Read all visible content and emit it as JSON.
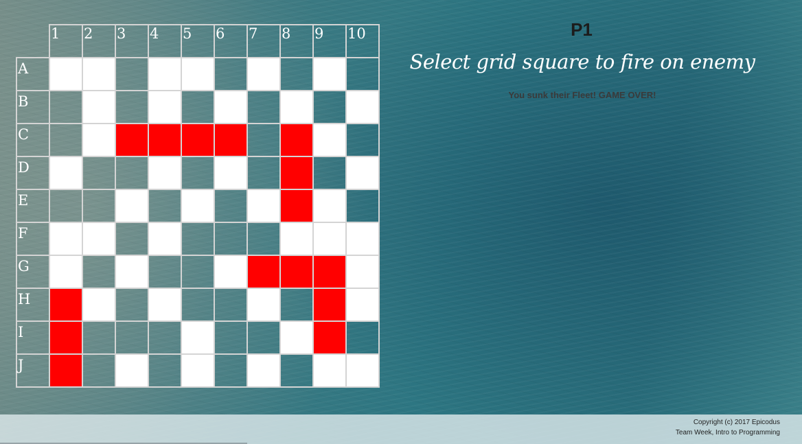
{
  "board": {
    "columns": [
      "1",
      "2",
      "3",
      "4",
      "5",
      "6",
      "7",
      "8",
      "9",
      "10"
    ],
    "rows": [
      {
        "label": "A",
        "cells": [
          "miss",
          "miss",
          "open",
          "miss",
          "miss",
          "open",
          "miss",
          "open",
          "miss",
          "open"
        ]
      },
      {
        "label": "B",
        "cells": [
          "open",
          "miss",
          "open",
          "miss",
          "open",
          "miss",
          "open",
          "miss",
          "open",
          "miss"
        ]
      },
      {
        "label": "C",
        "cells": [
          "open",
          "miss",
          "hit",
          "hit",
          "hit",
          "hit",
          "open",
          "hit",
          "miss",
          "open"
        ]
      },
      {
        "label": "D",
        "cells": [
          "miss",
          "open",
          "open",
          "miss",
          "open",
          "miss",
          "open",
          "hit",
          "open",
          "miss"
        ]
      },
      {
        "label": "E",
        "cells": [
          "open",
          "open",
          "miss",
          "open",
          "miss",
          "open",
          "miss",
          "hit",
          "miss",
          "open"
        ]
      },
      {
        "label": "F",
        "cells": [
          "miss",
          "miss",
          "open",
          "miss",
          "open",
          "open",
          "open",
          "miss",
          "miss",
          "miss"
        ]
      },
      {
        "label": "G",
        "cells": [
          "miss",
          "open",
          "miss",
          "open",
          "open",
          "miss",
          "hit",
          "hit",
          "hit",
          "miss"
        ]
      },
      {
        "label": "H",
        "cells": [
          "hit",
          "miss",
          "open",
          "miss",
          "open",
          "open",
          "miss",
          "open",
          "hit",
          "miss"
        ]
      },
      {
        "label": "I",
        "cells": [
          "hit",
          "open",
          "open",
          "open",
          "miss",
          "open",
          "open",
          "miss",
          "hit",
          "open"
        ]
      },
      {
        "label": "J",
        "cells": [
          "hit",
          "open",
          "miss",
          "open",
          "miss",
          "open",
          "miss",
          "open",
          "miss",
          "miss"
        ]
      }
    ],
    "colors": {
      "hit": "#ff0000",
      "miss": "#ffffff",
      "grid_line": "#d4d4d4"
    }
  },
  "panel": {
    "player": "P1",
    "instruction": "Select grid square to fire on enemy",
    "message": "You sunk their Fleet! GAME OVER!"
  },
  "footer": {
    "copyright": "Copyright (c) 2017 Epicodus",
    "credit": "Team Week, Intro to Programming"
  }
}
